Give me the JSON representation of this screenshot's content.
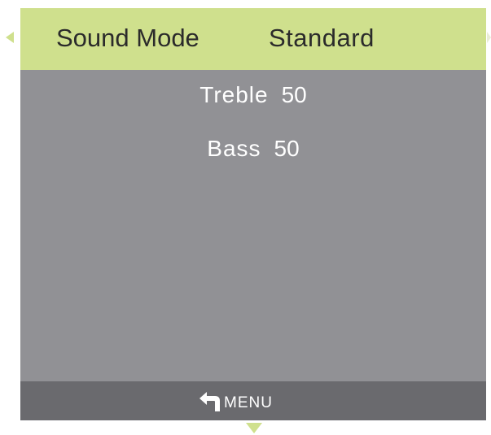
{
  "header": {
    "setting_label": "Sound Mode",
    "setting_value": "Standard"
  },
  "settings": [
    {
      "label": "Treble",
      "value": "50"
    },
    {
      "label": "Bass",
      "value": "50"
    }
  ],
  "footer": {
    "menu_label": "MENU",
    "back_icon": "return-arrow-icon"
  },
  "colors": {
    "header_background": "#cfe08d",
    "panel_background": "#919195",
    "footer_background": "#6a6a6e",
    "text_light": "#ffffff",
    "text_dark": "#2b2b2b"
  }
}
